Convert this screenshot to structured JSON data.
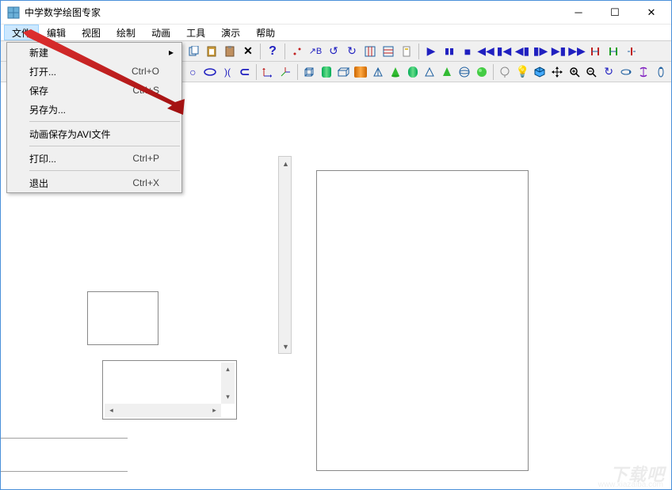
{
  "window": {
    "title": "中学数学绘图专家"
  },
  "menubar": {
    "items": [
      {
        "label": "文件",
        "active": true
      },
      {
        "label": "编辑"
      },
      {
        "label": "视图"
      },
      {
        "label": "绘制"
      },
      {
        "label": "动画"
      },
      {
        "label": "工具"
      },
      {
        "label": "演示"
      },
      {
        "label": "帮助"
      }
    ]
  },
  "file_menu": {
    "items": [
      {
        "label": "新建",
        "shortcut": "",
        "submenu": true
      },
      {
        "label": "打开...",
        "shortcut": "Ctrl+O"
      },
      {
        "label": "保存",
        "shortcut": "Ctrl+S"
      },
      {
        "label": "另存为..."
      },
      {
        "sep": true
      },
      {
        "label": "动画保存为AVI文件"
      },
      {
        "sep": true
      },
      {
        "label": "打印...",
        "shortcut": "Ctrl+P"
      },
      {
        "sep": true
      },
      {
        "label": "退出",
        "shortcut": "Ctrl+X"
      }
    ]
  },
  "watermark": {
    "main": "下载吧",
    "sub": "www.xiazaiba.com"
  }
}
